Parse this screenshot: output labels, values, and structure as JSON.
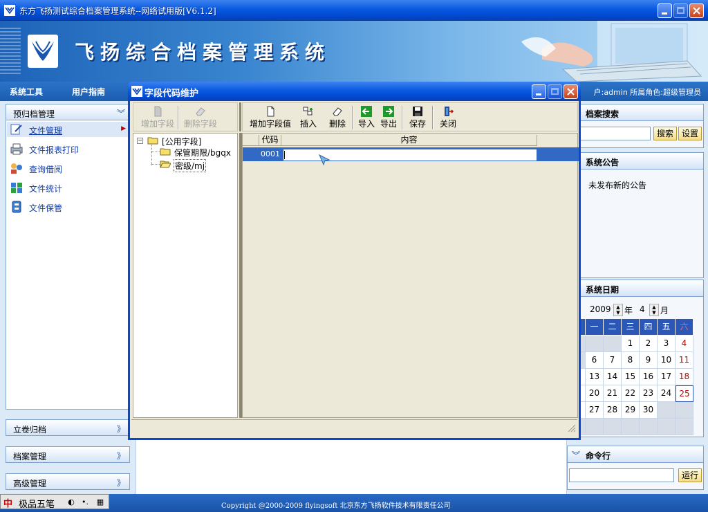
{
  "window": {
    "title": "东方飞扬测试综合档案管理系统--网络试用版[V6.1.2]"
  },
  "banner": {
    "title": "飞扬综合档案管理系统"
  },
  "menubar": {
    "items": [
      "系统工具",
      "用户指南"
    ],
    "user_info": "户:admin  所属角色:超级管理员"
  },
  "left_sidebar": {
    "top_section": "预归档管理",
    "items": [
      {
        "label": "文件管理",
        "icon": "file-manage-icon"
      },
      {
        "label": "文件报表打印",
        "icon": "printer-icon"
      },
      {
        "label": "查询借阅",
        "icon": "people-search-icon"
      },
      {
        "label": "文件统计",
        "icon": "statistics-icon"
      },
      {
        "label": "文件保管",
        "icon": "archive-storage-icon"
      }
    ],
    "sections": [
      "立卷归档",
      "档案管理",
      "高级管理"
    ]
  },
  "right_sidebar": {
    "search_title": "档案搜索",
    "search_value": "",
    "search_button": "搜索",
    "settings_button": "设置",
    "notice_title": "系统公告",
    "notice_text": "未发布新的公告",
    "date_title": "系统日期",
    "year": "2009",
    "year_suffix": "年",
    "month": "4",
    "month_suffix": "月",
    "weekdays": [
      "一",
      "二",
      "三",
      "四",
      "五",
      "六"
    ],
    "weeks": [
      [
        "",
        "",
        "",
        "1",
        "2",
        "3",
        "4"
      ],
      [
        "",
        "6",
        "7",
        "8",
        "9",
        "10",
        "11"
      ],
      [
        "2",
        "13",
        "14",
        "15",
        "16",
        "17",
        "18"
      ],
      [
        "9",
        "20",
        "21",
        "22",
        "23",
        "24",
        "25"
      ],
      [
        "6",
        "27",
        "28",
        "29",
        "30",
        "",
        ""
      ],
      [
        "",
        "",
        "",
        "",
        "",
        "",
        ""
      ]
    ],
    "today": "25",
    "command_title": "命令行",
    "command_value": "",
    "run_button": "运行"
  },
  "dialog": {
    "title": "字段代码维护",
    "toolbar_left": [
      {
        "label": "增加字段",
        "icon": "add-field-icon",
        "enabled": false
      },
      {
        "label": "删除字段",
        "icon": "delete-field-icon",
        "enabled": false
      }
    ],
    "toolbar_right": [
      {
        "label": "增加字段值",
        "icon": "new-document-icon"
      },
      {
        "label": "插入",
        "icon": "insert-icon"
      },
      {
        "label": "删除",
        "icon": "eraser-icon"
      },
      {
        "label": "导入",
        "icon": "import-arrow-icon"
      },
      {
        "label": "导出",
        "icon": "export-arrow-icon"
      },
      {
        "label": "保存",
        "icon": "save-disk-icon"
      },
      {
        "label": "关闭",
        "icon": "exit-door-icon"
      }
    ],
    "tree": {
      "root": "[公用字段]",
      "children": [
        "保管期限/bgqx",
        "密级/mj"
      ]
    },
    "grid": {
      "columns": [
        "代码",
        "内容"
      ],
      "rows": [
        {
          "code": "0001",
          "content": ""
        }
      ]
    }
  },
  "footer": {
    "copyright": "Copyright @2000-2009 flyingsoft 北京东方飞扬软件技术有限责任公司",
    "ime_zh": "中",
    "ime_label": "极品五笔"
  },
  "colors": {
    "xp_blue": "#0a5ae0",
    "selection": "#316ac5",
    "panel_bg": "#dce9f7",
    "dialog_bg": "#ece9d8"
  }
}
